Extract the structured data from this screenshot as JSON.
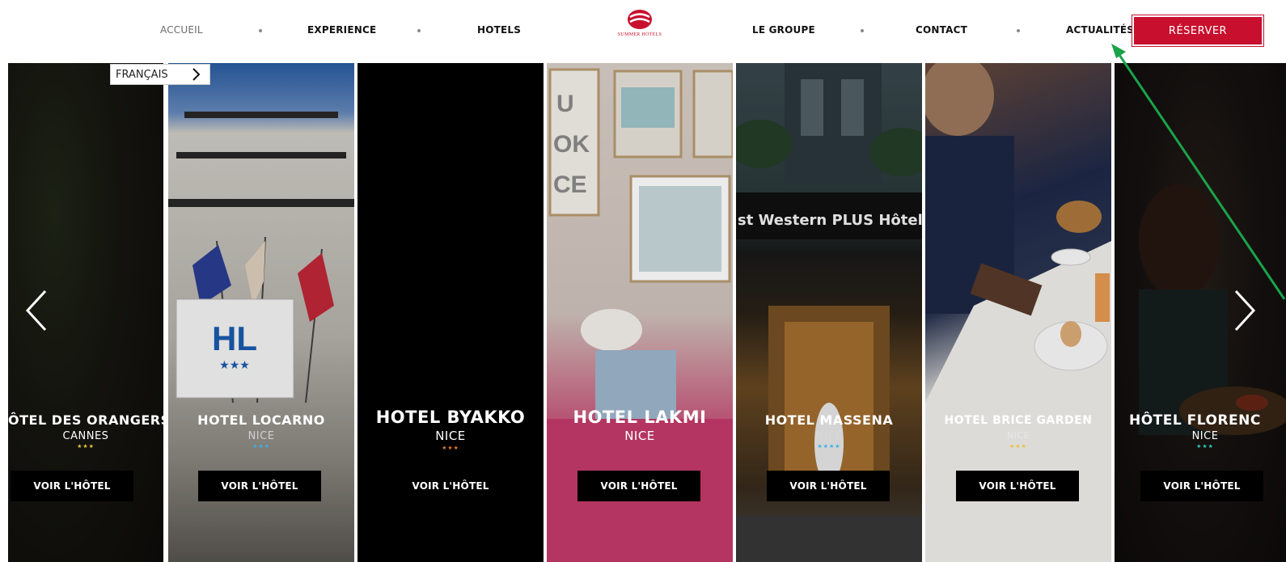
{
  "nav": {
    "items": [
      "ACCUEIL",
      "EXPERIENCE",
      "HOTELS",
      "LE GROUPE",
      "CONTACT",
      "ACTUALITÉS"
    ],
    "logo_text": "SUMMER HOTELS",
    "reserve_label": "RÉSERVER"
  },
  "language": {
    "label": "FRANÇAIS",
    "chevron_icon": "chevron-right-icon"
  },
  "carousel": {
    "prev_icon": "chevron-left-icon",
    "next_icon": "chevron-right-icon",
    "hotels": [
      {
        "name": "ÔTEL DES ORANGERS",
        "city": "CANNES",
        "stars": "★★★",
        "star_color": "#e8c33a",
        "button": "VOIR L'HÔTEL"
      },
      {
        "name": "HOTEL LOCARNO",
        "city": "NICE",
        "stars": "★★★",
        "star_color": "#3ab0e8",
        "button": "VOIR L'HÔTEL"
      },
      {
        "name": "HOTEL BYAKKO",
        "city": "NICE",
        "stars": "★★★",
        "star_color": "#e07a2a",
        "button": "VOIR L'HÔTEL"
      },
      {
        "name": "HOTEL LAKMI",
        "city": "NICE",
        "stars": "",
        "star_color": "#ffffff",
        "button": "VOIR L'HÔTEL"
      },
      {
        "name": "HOTEL MASSENA",
        "city": "NICE",
        "stars": "★★★★",
        "star_color": "#3ab0e8",
        "button": "VOIR L'HÔTEL"
      },
      {
        "name": "HOTEL BRICE GARDEN",
        "city": "NICE",
        "stars": "★★★",
        "star_color": "#e8c33a",
        "button": "VOIR L'HÔTEL"
      },
      {
        "name": "HÔTEL FLORENC",
        "city": "NICE",
        "stars": "★★★",
        "star_color": "#2ac8b0",
        "button": "VOIR L'HÔTEL"
      }
    ],
    "photo_text": "st Western PLUS Hôtel M"
  },
  "colors": {
    "brand_red": "#c8102e",
    "pointer_green": "#1aa34a"
  }
}
